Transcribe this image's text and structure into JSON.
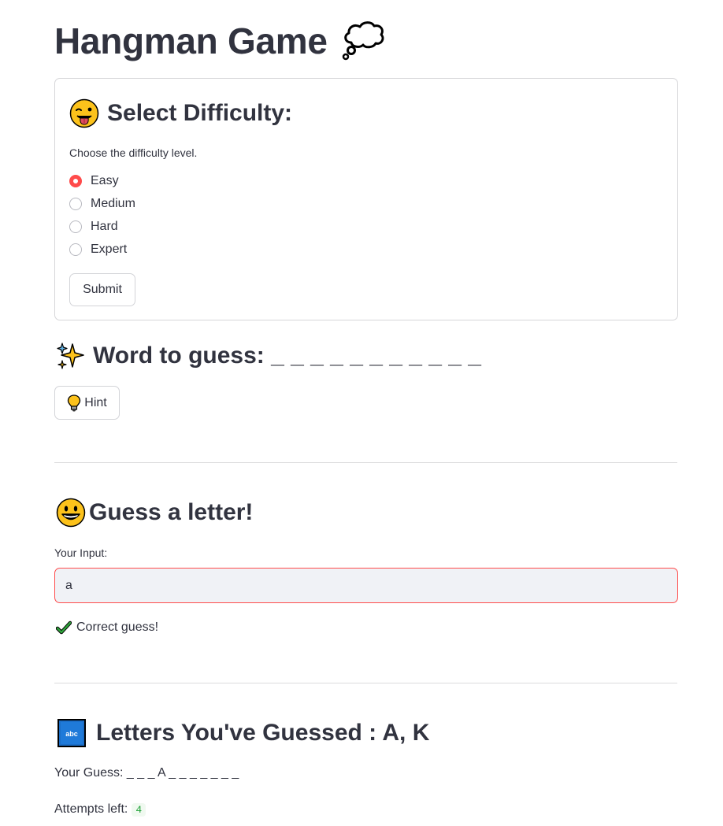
{
  "title": "Hangman Game",
  "title_icon": "thought-balloon-icon",
  "difficulty_form": {
    "heading": "Select Difficulty:",
    "heading_icon": "winking-face-with-tongue-icon",
    "label": "Choose the difficulty level.",
    "options": [
      {
        "label": "Easy",
        "selected": true
      },
      {
        "label": "Medium",
        "selected": false
      },
      {
        "label": "Hard",
        "selected": false
      },
      {
        "label": "Expert",
        "selected": false
      }
    ],
    "submit_label": "Submit"
  },
  "word": {
    "heading": "Word to guess: _ _ _ _ _ _ _ _ _ _ _",
    "heading_icon": "sparkles-icon",
    "hint_label": "Hint",
    "hint_icon": "light-bulb-icon"
  },
  "guess": {
    "heading": "Guess a letter!",
    "heading_icon": "grinning-face-icon",
    "input_label": "Your Input:",
    "input_value": "a",
    "status_text": "Correct guess!",
    "status_icon": "check-mark-icon"
  },
  "letters": {
    "heading": "Letters You've Guessed : A, K",
    "heading_icon": "abc-icon",
    "your_guess": "Your Guess: _ _ _ A _ _ _ _ _ _ _",
    "attempts_label": "Attempts left:",
    "attempts_value": "4"
  },
  "colors": {
    "accent": "#ff4b4b",
    "text": "#31333f",
    "success": "#21a33a",
    "input_bg": "#f0f2f6"
  }
}
